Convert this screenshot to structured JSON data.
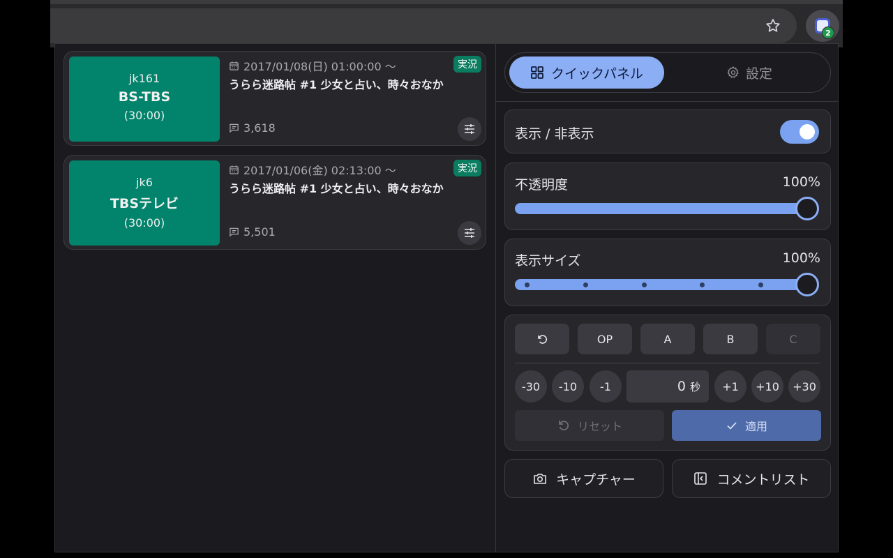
{
  "browser": {
    "star_icon": "star-icon",
    "extension_badge": "2"
  },
  "programs": [
    {
      "jk": "jk161",
      "channel": "BS-TBS",
      "duration": "(30:00)",
      "date": "2017/01/08(日) 01:00:00 〜",
      "title": "うらら迷路帖 #1 少女と占い、時々おなか",
      "badge": "実況",
      "comment_count": "3,618"
    },
    {
      "jk": "jk6",
      "channel": "TBSテレビ",
      "duration": "(30:00)",
      "date": "2017/01/06(金) 02:13:00 〜",
      "title": "うらら迷路帖 #1 少女と占い、時々おなか",
      "badge": "実況",
      "comment_count": "5,501"
    }
  ],
  "tabs": {
    "quick_panel": "クイックパネル",
    "settings": "設定"
  },
  "visibility": {
    "label": "表示 / 非表示",
    "enabled": true
  },
  "opacity": {
    "label": "不透明度",
    "value_text": "100%",
    "value": 1.0
  },
  "display_size": {
    "label": "表示サイズ",
    "value_text": "100%",
    "value": 1.0,
    "step_marks": 5
  },
  "presets": {
    "op": "OP",
    "a": "A",
    "b": "B",
    "c": "C"
  },
  "offset": {
    "minus30": "-30",
    "minus10": "-10",
    "minus1": "-1",
    "value": "0",
    "unit": "秒",
    "plus1": "+1",
    "plus10": "+10",
    "plus30": "+30",
    "reset": "リセット",
    "apply": "適用"
  },
  "actions": {
    "capture": "キャプチャー",
    "comment_list": "コメントリスト"
  },
  "colors": {
    "accent": "#8caef5",
    "channel_bg": "#02836b",
    "badge_bg": "#0a7c5f"
  }
}
